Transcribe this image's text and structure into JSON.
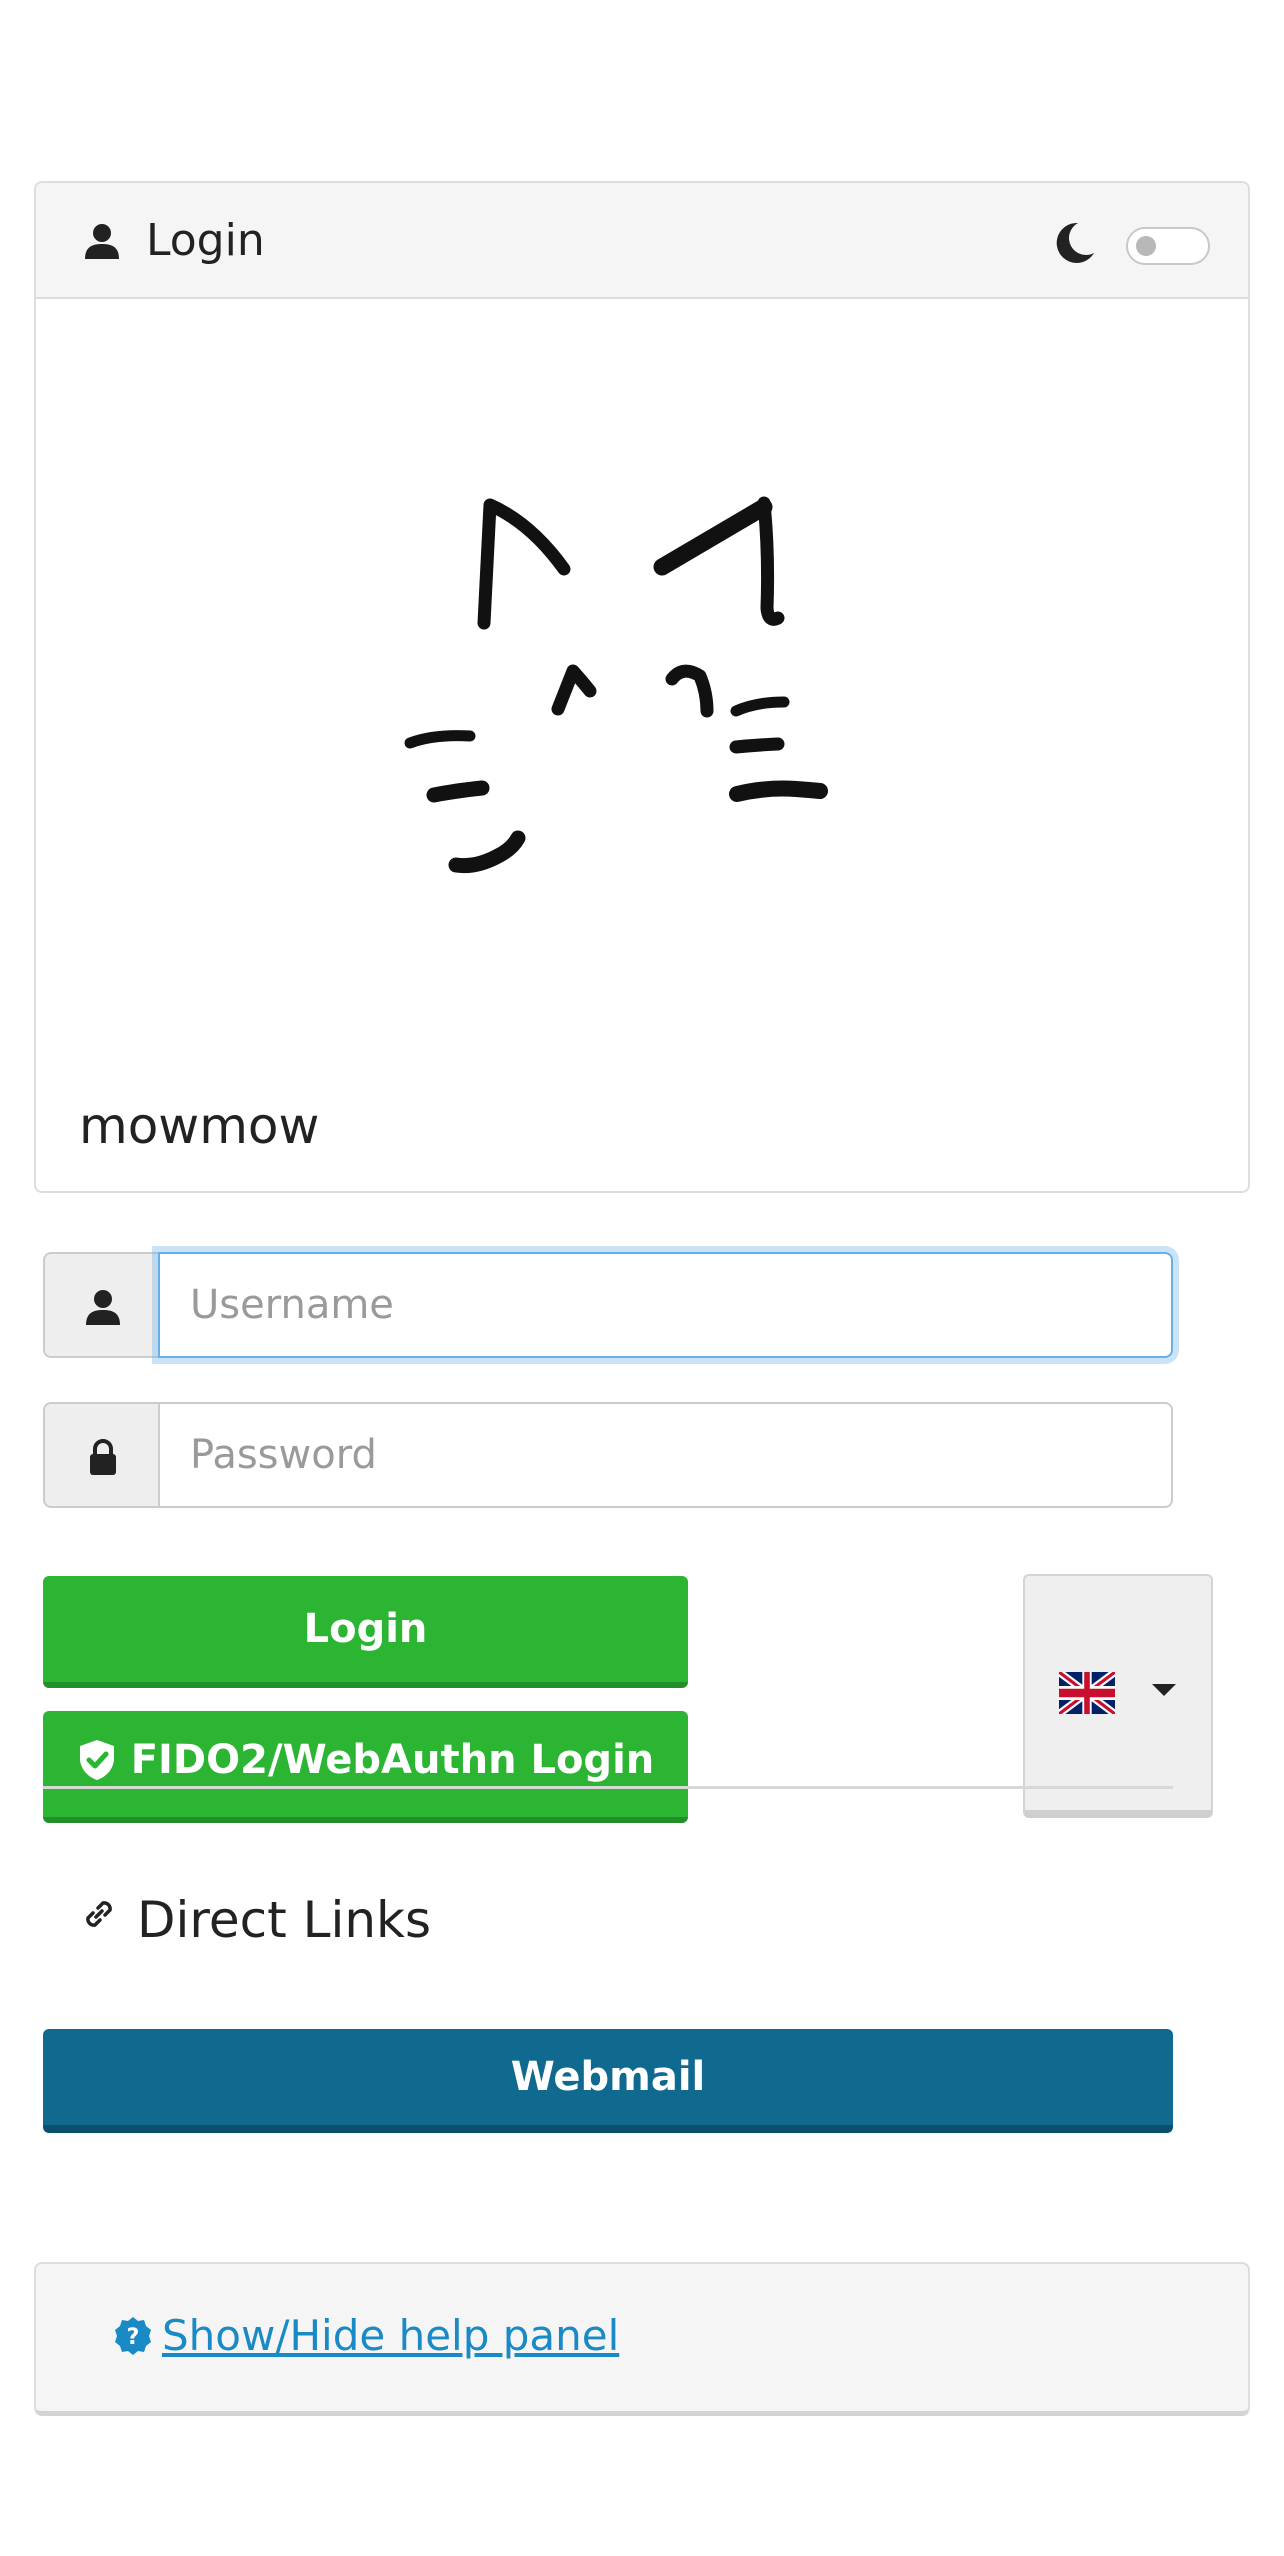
{
  "header": {
    "title": "Login",
    "dark_mode_enabled": false
  },
  "site_name": "mowmow",
  "form": {
    "username_placeholder": "Username",
    "password_placeholder": "Password",
    "login_label": "Login",
    "fido_label": "FIDO2/WebAuthn Login"
  },
  "language": {
    "selected_flag": "uk-flag-icon"
  },
  "direct_links": {
    "heading": "Direct Links",
    "webmail_label": "Webmail"
  },
  "help": {
    "toggle_label": "Show/Hide help panel"
  },
  "colors": {
    "primary_green": "#2bb532",
    "webmail_blue": "#106a8f",
    "link_blue": "#1a8ac6"
  }
}
